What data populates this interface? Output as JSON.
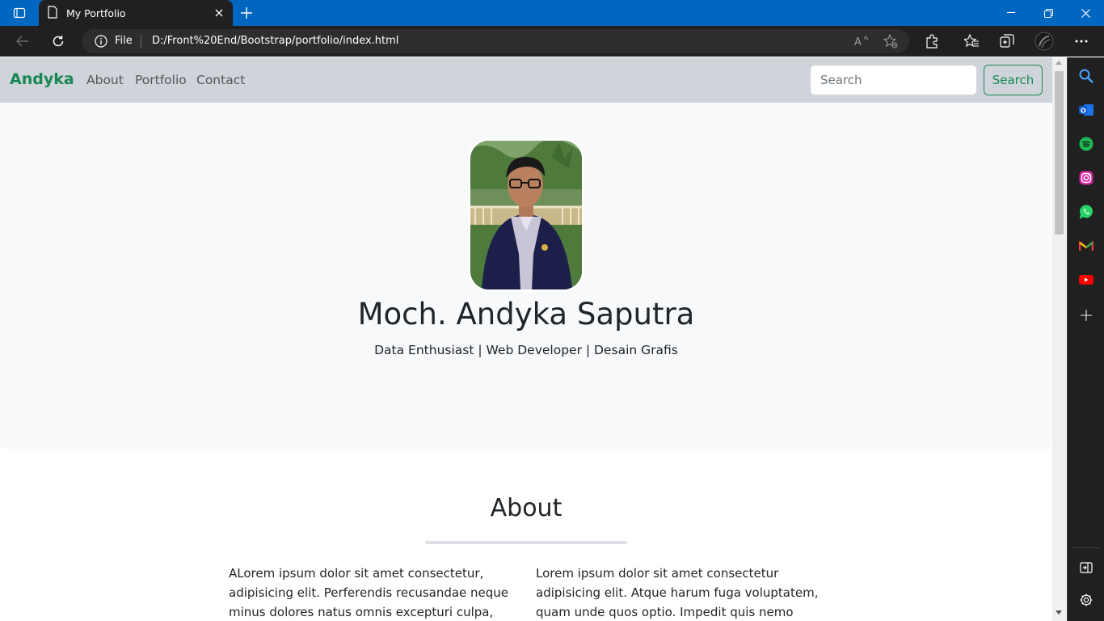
{
  "browser": {
    "tab_title": "My Portfolio",
    "address_prefix": "File",
    "url": "D:/Front%20End/Bootstrap/portfolio/index.html"
  },
  "navbar": {
    "brand": "Andyka",
    "links": [
      "About",
      "Portfolio",
      "Contact"
    ],
    "search_placeholder": "Search",
    "search_button": "Search"
  },
  "hero": {
    "name": "Moch. Andyka Saputra",
    "subtitle": "Data Enthusiast | Web Developer | Desain Grafis"
  },
  "about": {
    "title": "About",
    "col1": "ALorem ipsum dolor sit amet consectetur, adipisicing elit. Perferendis recusandae neque minus dolores natus omnis excepturi culpa, magni",
    "col2": "Lorem ipsum dolor sit amet consectetur adipisicing elit. Atque harum fuga voluptatem, quam unde quos optio. Impedit quis nemo"
  },
  "colors": {
    "accent": "#198754",
    "titlebar": "#0067c0",
    "navbar_bg": "#ced4da",
    "hero_bg": "#f8f9fa"
  },
  "sidebar_icons": [
    "search-icon",
    "outlook-icon",
    "spotify-icon",
    "instagram-icon",
    "whatsapp-icon",
    "gmail-icon",
    "youtube-icon",
    "add-icon",
    "panel-icon",
    "settings-icon"
  ]
}
